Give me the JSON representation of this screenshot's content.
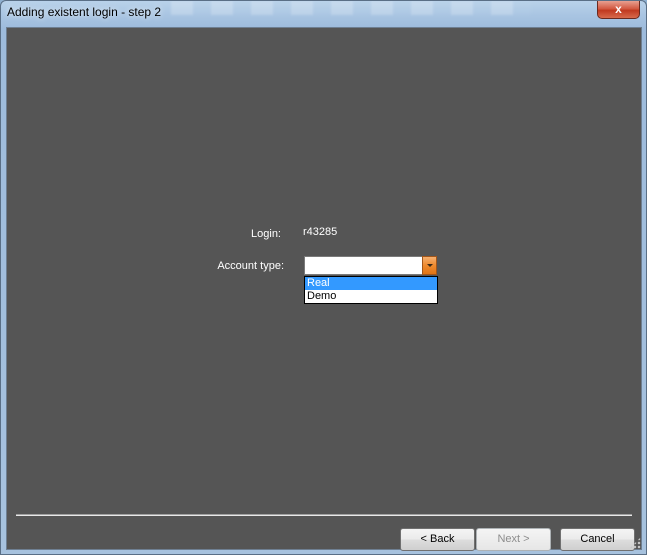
{
  "window": {
    "title": "Adding existent login - step 2",
    "close_label": "x"
  },
  "form": {
    "login_label": "Login:",
    "login_value": "r43285",
    "account_type_label": "Account type:",
    "account_type_value": "",
    "account_type_options": [
      "Real",
      "Demo"
    ],
    "highlighted_option": "Real"
  },
  "buttons": {
    "back_label": "< Back",
    "next_label": "Next >",
    "cancel_label": "Cancel"
  },
  "colors": {
    "client_background": "#555555",
    "selection": "#3399ff",
    "combo_arrow": "#ef8a2e"
  }
}
